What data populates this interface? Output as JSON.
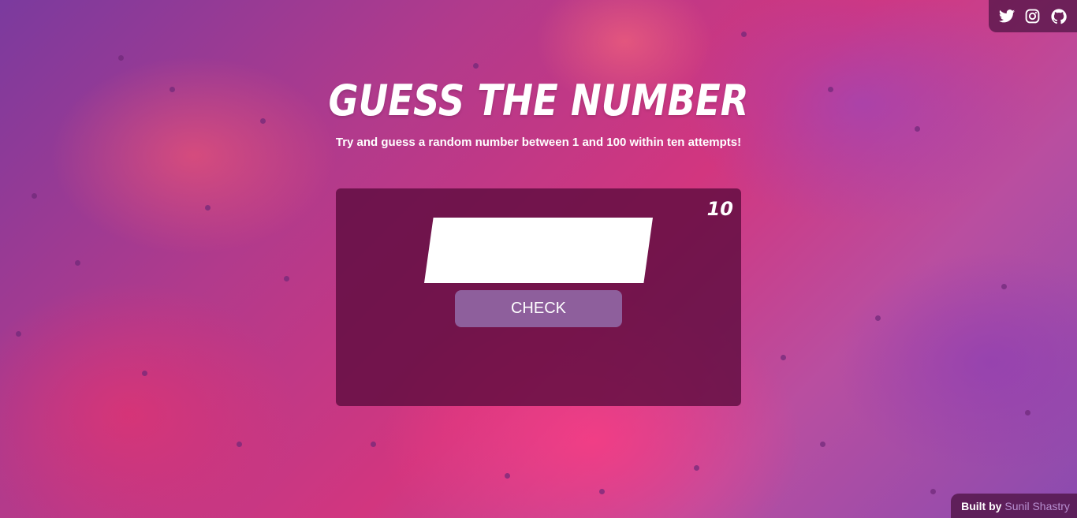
{
  "header": {
    "title": "GUESS THE NUMBER",
    "subtitle": "Try and guess a random number between 1 and 100 within ten attempts!"
  },
  "social": {
    "icons": [
      "twitter-icon",
      "instagram-icon",
      "github-icon"
    ]
  },
  "game": {
    "attempts_left": "10",
    "input_value": "",
    "check_label": "CHECK"
  },
  "footer": {
    "built_label": "Built by",
    "author": "Sunil Shastry"
  },
  "colors": {
    "card": "#5a0a3c",
    "button": "#8e5f9c",
    "author_link": "#b78fd0"
  }
}
